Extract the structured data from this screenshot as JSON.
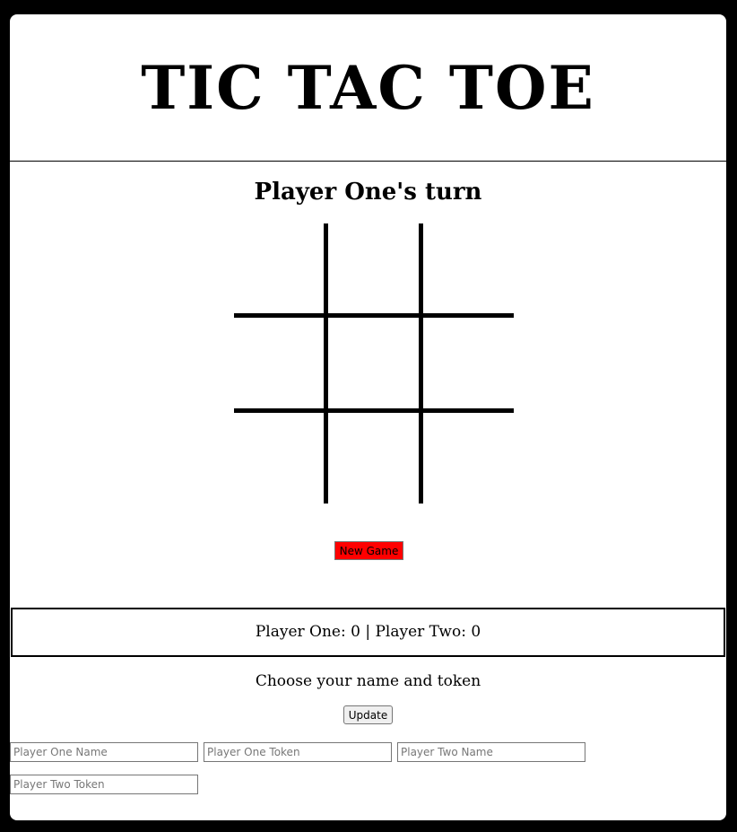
{
  "header": {
    "title": "TIC TAC TOE"
  },
  "game": {
    "turn_text": "Player One's turn",
    "board": [
      "",
      "",
      "",
      "",
      "",
      "",
      "",
      "",
      ""
    ],
    "new_game_label": "New Game",
    "new_game_color": "#ff0000"
  },
  "score": {
    "text": "Player One: 0 | Player Two: 0",
    "player_one": 0,
    "player_two": 0
  },
  "setup": {
    "title": "Choose your name and token",
    "update_label": "Update",
    "player_one_name_placeholder": "Player One Name",
    "player_one_token_placeholder": "Player One Token",
    "player_two_name_placeholder": "Player Two Name",
    "player_two_token_placeholder": "Player Two Token"
  }
}
